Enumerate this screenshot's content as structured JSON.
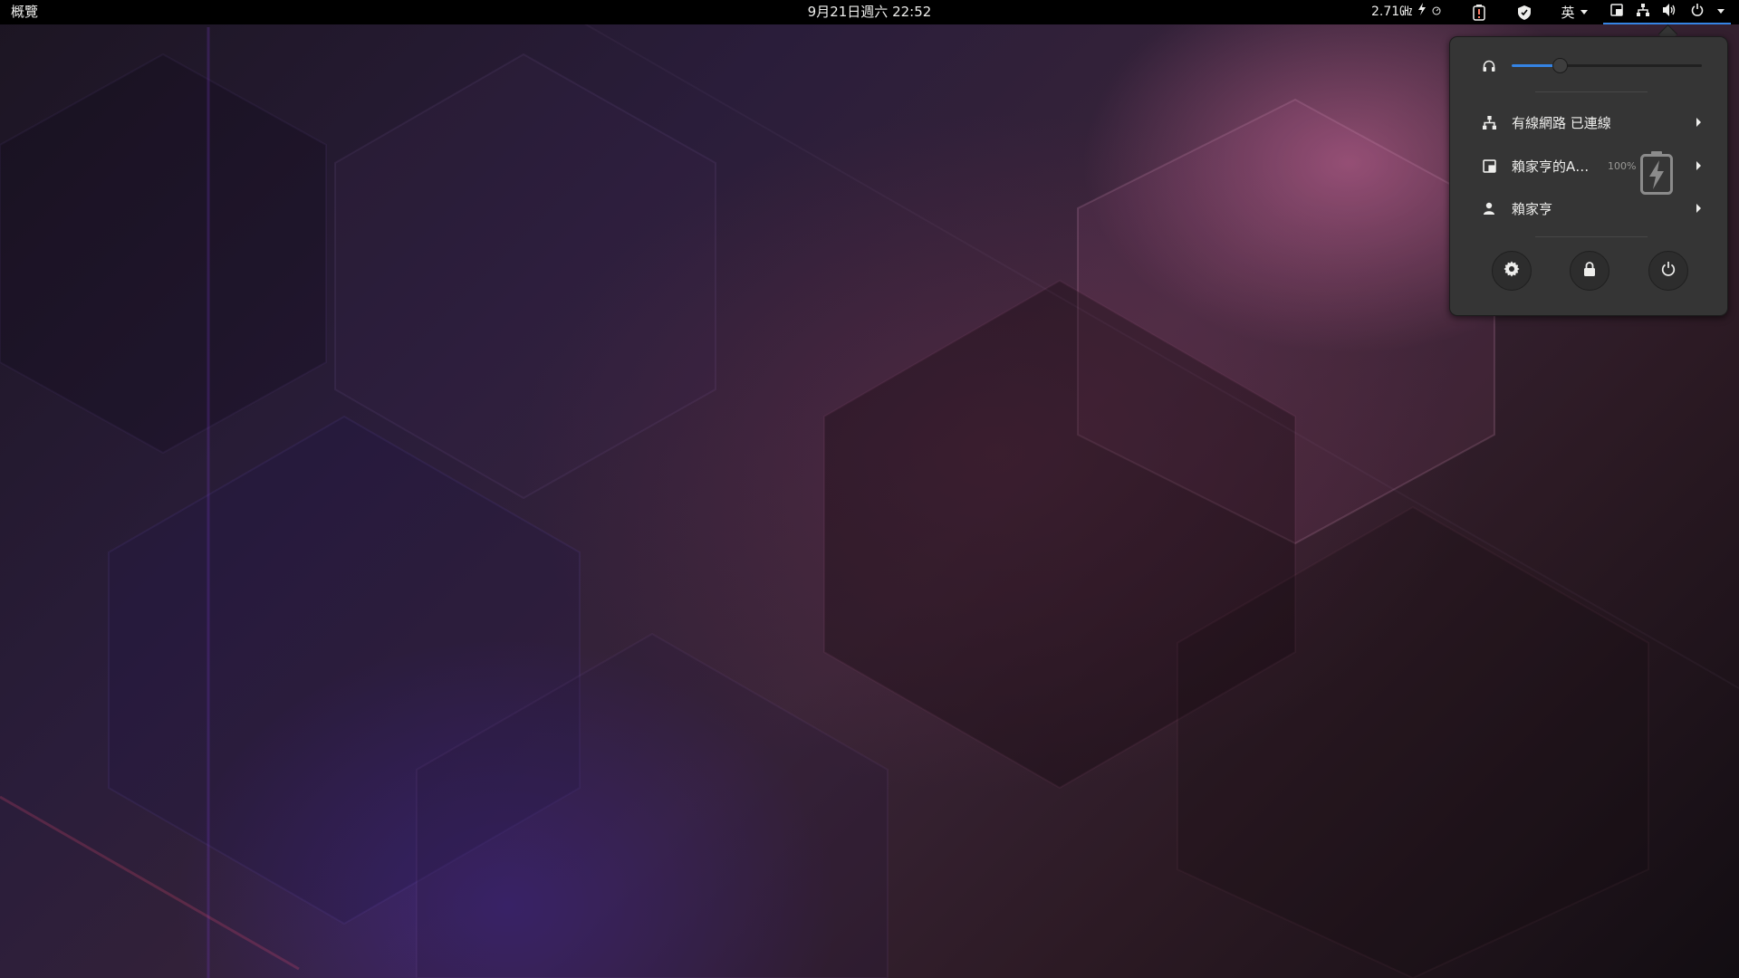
{
  "topbar": {
    "activities_label": "概覽",
    "clock": "9月21日週六  22:52",
    "cpu_freq": "2.71㎓",
    "input_method": "英",
    "icons": [
      "lightning-icon",
      "gauge-icon",
      "battery-alert-icon",
      "shield-icon",
      "display-icon",
      "network-wired-icon",
      "volume-icon",
      "power-icon"
    ]
  },
  "system_menu": {
    "volume": {
      "icon": "headphones-icon",
      "level": 0.25
    },
    "items": [
      {
        "icon": "network-wired-icon",
        "label": "有線網路 已連線"
      },
      {
        "icon": "display-icon",
        "label": "賴家亨的A…",
        "battery_percent": "100%"
      },
      {
        "icon": "user-icon",
        "label": "賴家亨"
      }
    ],
    "buttons": [
      "settings-icon",
      "lock-icon",
      "power-icon"
    ]
  },
  "colors": {
    "topbar_bg": "#000000",
    "menu_bg": "#353535",
    "accent": "#3584e4",
    "text": "#eeeeec"
  }
}
